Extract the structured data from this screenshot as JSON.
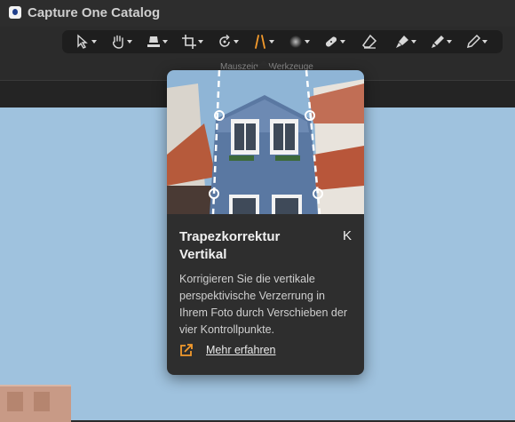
{
  "window": {
    "title": "Capture One Catalog"
  },
  "toolbar": {
    "label": "Mauszeiger Werkzeuge",
    "tools": [
      {
        "icon": "select-arrow-icon"
      },
      {
        "icon": "pan-hand-icon"
      },
      {
        "icon": "straighten-icon"
      },
      {
        "icon": "crop-icon"
      },
      {
        "icon": "rotate-icon"
      },
      {
        "icon": "keystone-icon",
        "active": true
      },
      {
        "icon": "spot-icon"
      },
      {
        "icon": "healing-brush-icon"
      },
      {
        "icon": "eraser-icon"
      },
      {
        "icon": "clone-brush-icon"
      },
      {
        "icon": "draw-mask-icon"
      },
      {
        "icon": "color-picker-icon"
      }
    ],
    "accent_color": "#f39a2c"
  },
  "tooltip": {
    "title": "Trapezkorrektur Vertikal",
    "shortcut": "K",
    "description": "Korrigieren Sie die vertikale perspektivische Verzerrung in Ihrem Foto durch Verschieben der vier Kontrollpunkte.",
    "link_label": "Mehr erfahren",
    "link_icon": "external-link-icon"
  }
}
